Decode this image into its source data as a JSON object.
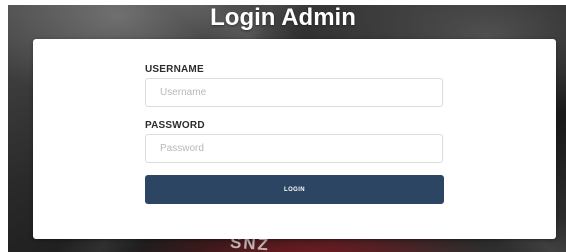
{
  "page": {
    "title": "Login Admin",
    "background_text": "SNZ"
  },
  "form": {
    "username": {
      "label": "USERNAME",
      "placeholder": "Username",
      "value": ""
    },
    "password": {
      "label": "PASSWORD",
      "placeholder": "Password",
      "value": ""
    },
    "submit_label": "LOGIN"
  },
  "colors": {
    "button_bg": "#2b4562",
    "card_bg": "#ffffff",
    "title_color": "#ffffff"
  }
}
